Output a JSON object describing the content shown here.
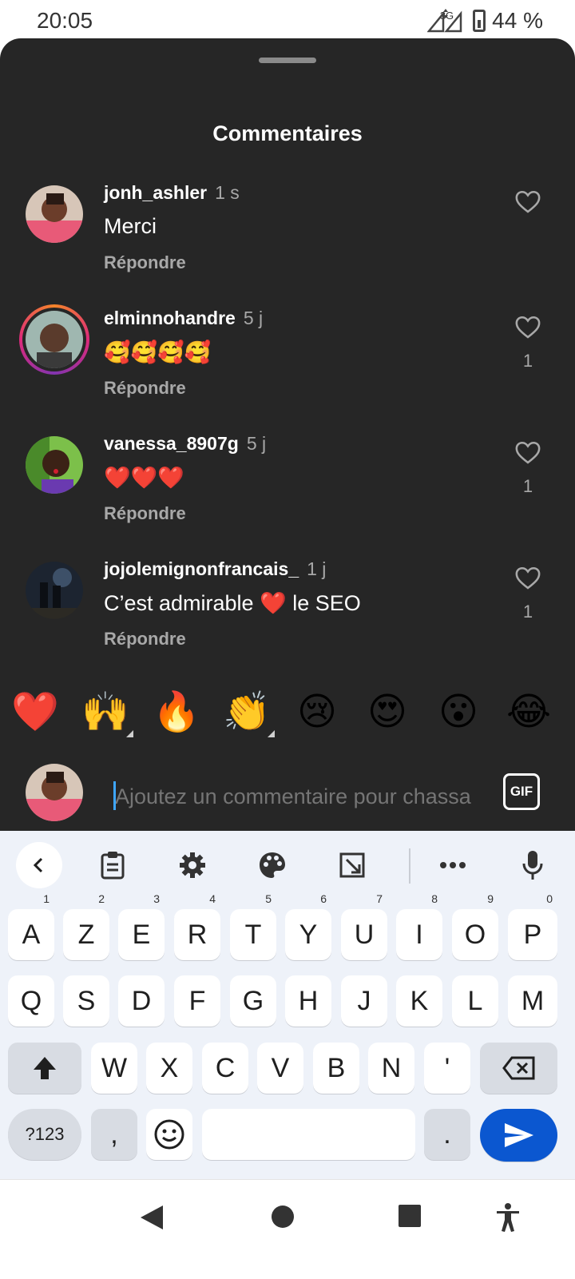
{
  "status_bar": {
    "time": "20:05",
    "network": "3G",
    "battery": "44 %"
  },
  "sheet": {
    "title": "Commentaires"
  },
  "comments": [
    {
      "username": "jonh_ashler",
      "time": "1 s",
      "text": "Merci",
      "reply": "Répondre",
      "likes": ""
    },
    {
      "username": "elminnohandre",
      "time": "5 j",
      "text": "🥰🥰🥰🥰",
      "reply": "Répondre",
      "likes": "1"
    },
    {
      "username": "vanessa_8907g",
      "time": "5 j",
      "text": "❤️❤️❤️",
      "reply": "Répondre",
      "likes": "1"
    },
    {
      "username": "jojolemignonfrancais_",
      "time": "1 j",
      "text": "C’est admirable ❤️ le SEO",
      "reply": "Répondre",
      "likes": "1"
    }
  ],
  "quick_emojis": [
    "❤️",
    "🙌",
    "🔥",
    "👏",
    "😢",
    "😍",
    "😮",
    "😂"
  ],
  "comment_input": {
    "placeholder": "Ajoutez un commentaire pour chassa",
    "gif_label": "GIF"
  },
  "keyboard": {
    "row1": [
      "A",
      "Z",
      "E",
      "R",
      "T",
      "Y",
      "U",
      "I",
      "O",
      "P"
    ],
    "row1_hints": [
      "1",
      "2",
      "3",
      "4",
      "5",
      "6",
      "7",
      "8",
      "9",
      "0"
    ],
    "row2": [
      "Q",
      "S",
      "D",
      "F",
      "G",
      "H",
      "J",
      "K",
      "L",
      "M"
    ],
    "row3": [
      "W",
      "X",
      "C",
      "V",
      "B",
      "N",
      "'"
    ],
    "symbols_label": "?123",
    "comma": ",",
    "period": "."
  },
  "colors": {
    "sheet_bg": "#262626",
    "keyboard_bg": "#eef2f9",
    "send_key": "#0b57d0",
    "caret": "#3ea6ff"
  }
}
